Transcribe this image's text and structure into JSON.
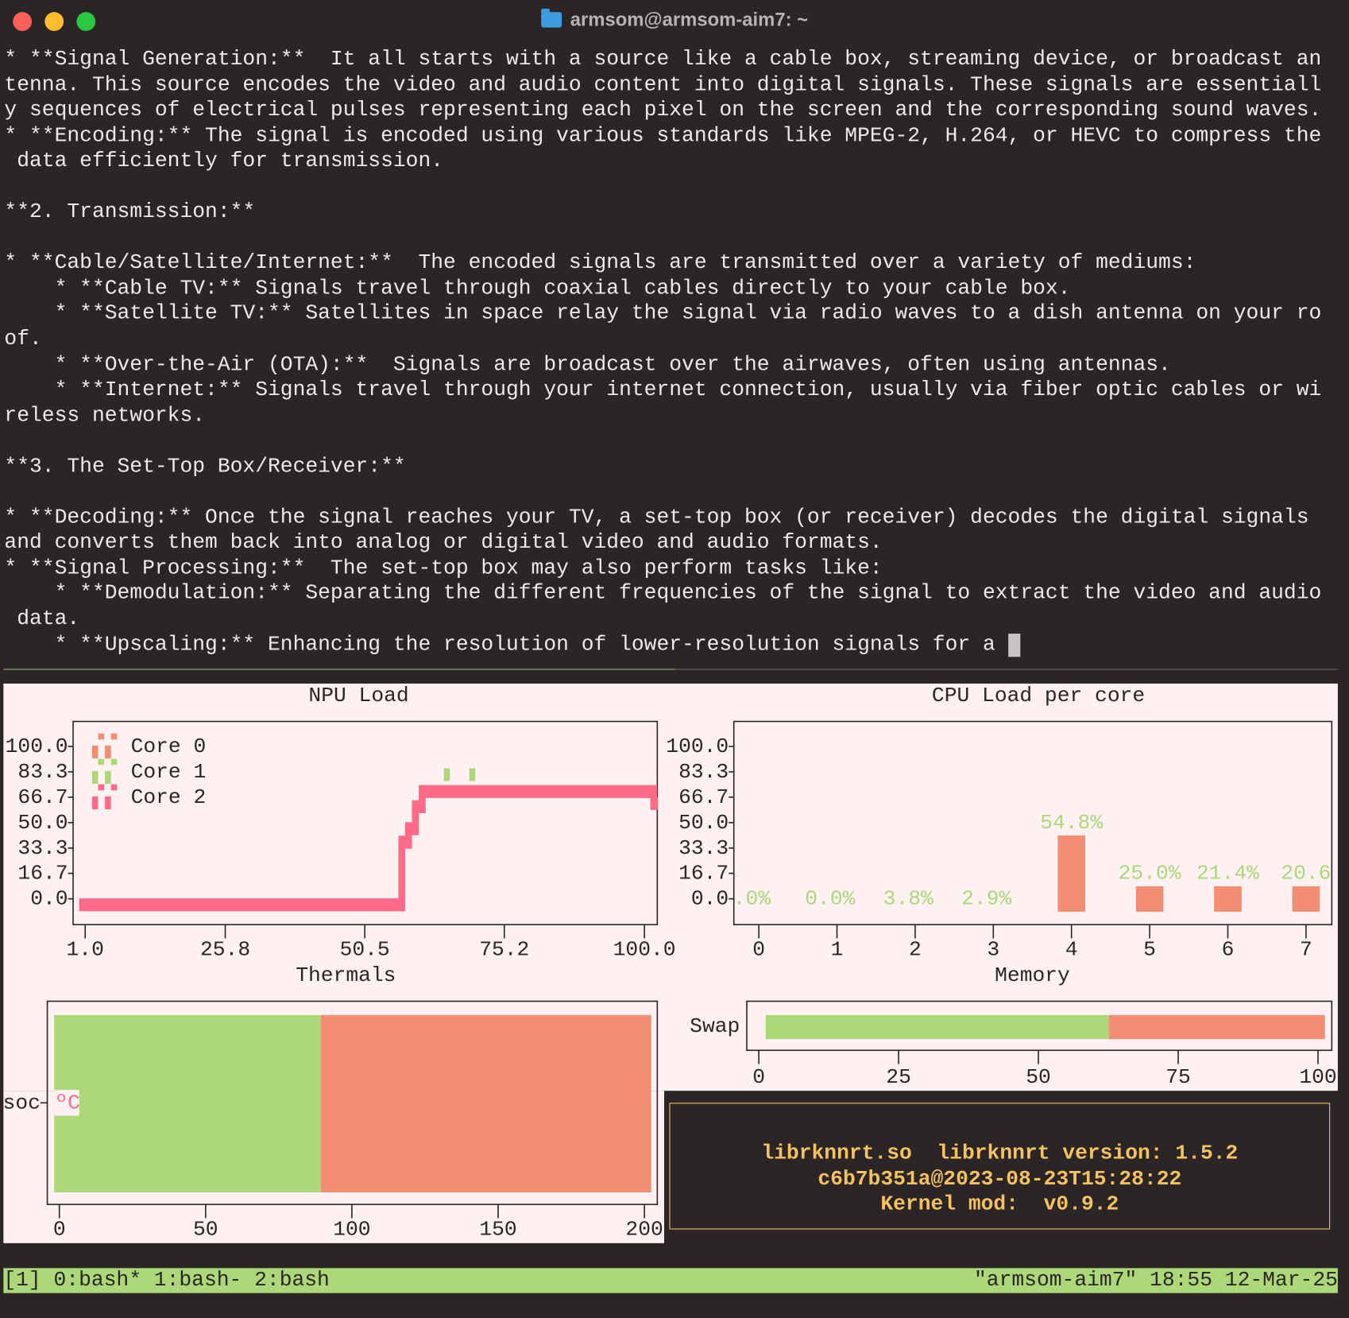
{
  "window": {
    "title": "armsom@armsom-aim7: ~",
    "buttons": {
      "close_color": "#fe5f57",
      "minimize_color": "#febc2e",
      "zoom_color": "#28c840"
    }
  },
  "terminal": {
    "lines": [
      "* **Signal Generation:**  It all starts with a source like a cable box, streaming device, or broadcast an",
      "tenna. This source encodes the video and audio content into digital signals. These signals are essentiall",
      "y sequences of electrical pulses representing each pixel on the screen and the corresponding sound waves.",
      "* **Encoding:** The signal is encoded using various standards like MPEG-2, H.264, or HEVC to compress the",
      " data efficiently for transmission.",
      "",
      "**2. Transmission:**",
      "",
      "* **Cable/Satellite/Internet:**  The encoded signals are transmitted over a variety of mediums:",
      "    * **Cable TV:** Signals travel through coaxial cables directly to your cable box.",
      "    * **Satellite TV:** Satellites in space relay the signal via radio waves to a dish antenna on your ro",
      "of.",
      "    * **Over-the-Air (OTA):**  Signals are broadcast over the airwaves, often using antennas.",
      "    * **Internet:** Signals travel through your internet connection, usually via fiber optic cables or wi",
      "reless networks.",
      "",
      "**3. The Set-Top Box/Receiver:**",
      "",
      "* **Decoding:** Once the signal reaches your TV, a set-top box (or receiver) decodes the digital signals",
      "and converts them back into analog or digital video and audio formats.",
      "* **Signal Processing:**  The set-top box may also perform tasks like:",
      "    * **Demodulation:** Separating the different frequencies of the signal to extract the video and audio",
      " data.",
      "    * **Upscaling:** Enhancing the resolution of lower-resolution signals for a"
    ]
  },
  "colors": {
    "background": "#2b2526",
    "panel": "#fff0f2",
    "core0": "#f28e72",
    "core1": "#acd87a",
    "core2": "#ff6b86",
    "bar_used": "#acd87a",
    "bar_rest": "#f28e72",
    "label_green": "#a8d87a",
    "info_text": "#f6c25f"
  },
  "chart_data": [
    {
      "type": "line",
      "title": "NPU Load",
      "yticks": [
        "100.0",
        "83.3",
        "66.7",
        "50.0",
        "33.3",
        "16.7",
        "0.0"
      ],
      "ytick_values": [
        100,
        83.3,
        66.7,
        50,
        33.3,
        16.7,
        0
      ],
      "xticks": [
        "1.0",
        "25.8",
        "50.5",
        "75.2",
        "100.0"
      ],
      "xtick_values": [
        1,
        25.8,
        50.5,
        75.2,
        100
      ],
      "xlim": [
        1,
        100
      ],
      "ylim": [
        0,
        100
      ],
      "legend_placement": "top-left",
      "series": [
        {
          "name": "Core 0",
          "color": "#f28e72",
          "points": []
        },
        {
          "name": "Core 1",
          "color": "#acd87a",
          "points": [
            [
              64.5,
              77
            ],
            [
              69,
              77
            ]
          ]
        },
        {
          "name": "Core 2",
          "color": "#ff6b86",
          "points": [
            [
              1,
              0
            ],
            [
              56.6,
              37
            ],
            [
              57.8,
              45
            ],
            [
              59.0,
              58
            ],
            [
              60.2,
              67
            ],
            [
              100,
              67
            ],
            [
              101.2,
              60
            ]
          ]
        }
      ]
    },
    {
      "type": "bar",
      "title": "CPU Load per core",
      "categories": [
        "0",
        "1",
        "2",
        "3",
        "4",
        "5",
        "6",
        "7"
      ],
      "values": [
        0.0,
        0.0,
        3.8,
        2.9,
        54.8,
        25.0,
        21.4,
        20.6
      ],
      "value_labels": [
        ".0%",
        "0.0%",
        "3.8%",
        "2.9%",
        "54.8%",
        "25.0%",
        "21.4%",
        "20.6"
      ],
      "yticks": [
        "100.0",
        "83.3",
        "66.7",
        "50.0",
        "33.3",
        "16.7",
        "0.0"
      ],
      "ytick_values": [
        100,
        83.3,
        66.7,
        50,
        33.3,
        16.7,
        0
      ],
      "ylim": [
        0,
        100
      ]
    },
    {
      "type": "bar",
      "orientation": "horizontal",
      "title": "Thermals",
      "categories": [
        "soc"
      ],
      "value_label": "ºC",
      "values": [
        89.4
      ],
      "xlim": [
        0,
        202
      ],
      "xticks": [
        "0",
        "50",
        "100",
        "150",
        "200"
      ],
      "xtick_values": [
        0,
        50,
        100,
        150,
        200
      ]
    },
    {
      "type": "bar",
      "orientation": "horizontal",
      "title": "Memory",
      "categories": [
        "Swap"
      ],
      "values": [
        62.6
      ],
      "xlim": [
        0,
        100
      ],
      "xticks": [
        "0",
        "25",
        "50",
        "75",
        "100"
      ],
      "xtick_values": [
        0,
        25,
        50,
        75,
        100
      ]
    }
  ],
  "info": {
    "line1": "librknnrt.so  librknnrt version: 1.5.2",
    "line2": "c6b7b351a@2023-08-23T15:28:22",
    "line3": "Kernel mod:  v0.9.2"
  },
  "statusbar": {
    "left": "[1] 0:bash* 1:bash- 2:bash",
    "right": "\"armsom-aim7\" 18:55 12-Mar-25"
  }
}
